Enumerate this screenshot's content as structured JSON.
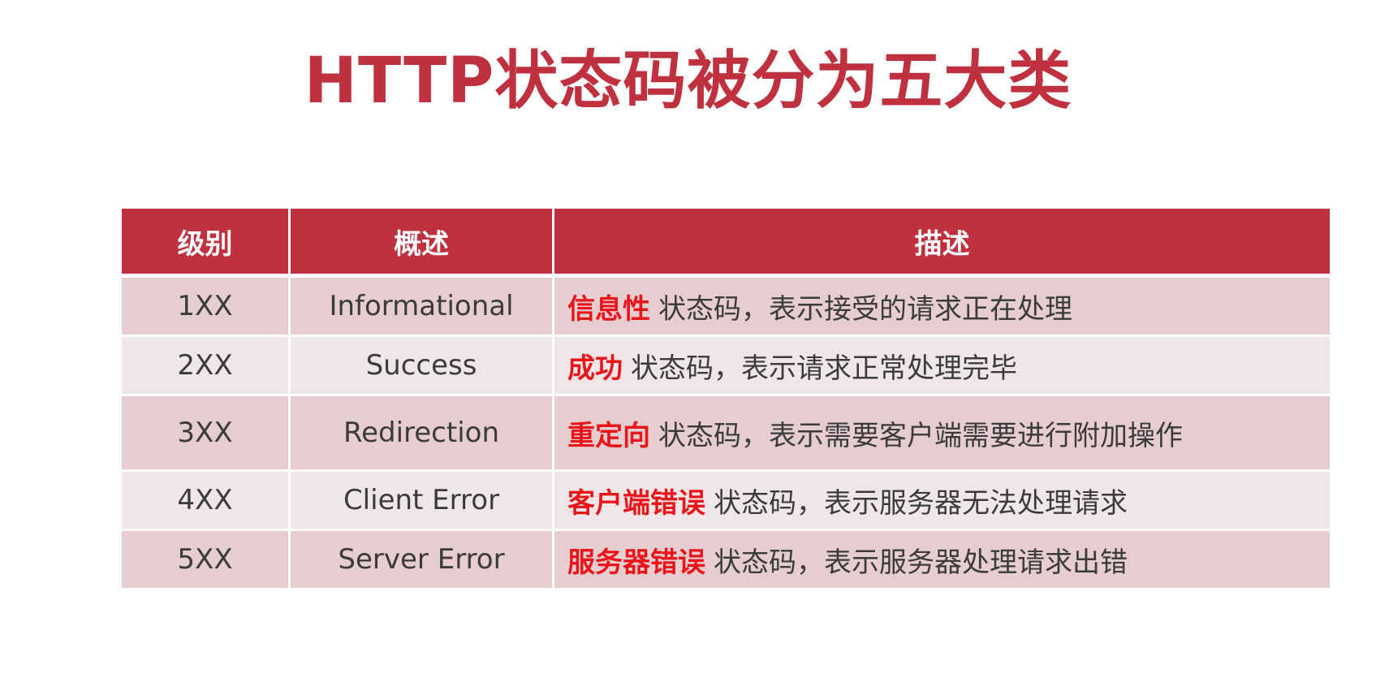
{
  "title": "HTTP状态码被分为五大类",
  "table": {
    "headers": {
      "level": "级别",
      "summary": "概述",
      "description": "描述"
    },
    "rows": [
      {
        "level": "1XX",
        "summary": "Informational",
        "highlight": "信息性",
        "description": "状态码，表示接受的请求正在处理"
      },
      {
        "level": "2XX",
        "summary": "Success",
        "highlight": "成功",
        "description": "状态码，表示请求正常处理完毕"
      },
      {
        "level": "3XX",
        "summary": "Redirection",
        "highlight": "重定向",
        "description": "状态码，表示需要客户端需要进行附加操作"
      },
      {
        "level": "4XX",
        "summary": "Client Error",
        "highlight": "客户端错误",
        "description": "状态码，表示服务器无法处理请求"
      },
      {
        "level": "5XX",
        "summary": "Server Error",
        "highlight": "服务器错误",
        "description": "状态码，表示服务器处理请求出错"
      }
    ]
  },
  "colors": {
    "accent": "#c0313f",
    "highlight": "#e8151b",
    "row_dark": "#e6cdcf",
    "row_light": "#f1e6e7"
  }
}
